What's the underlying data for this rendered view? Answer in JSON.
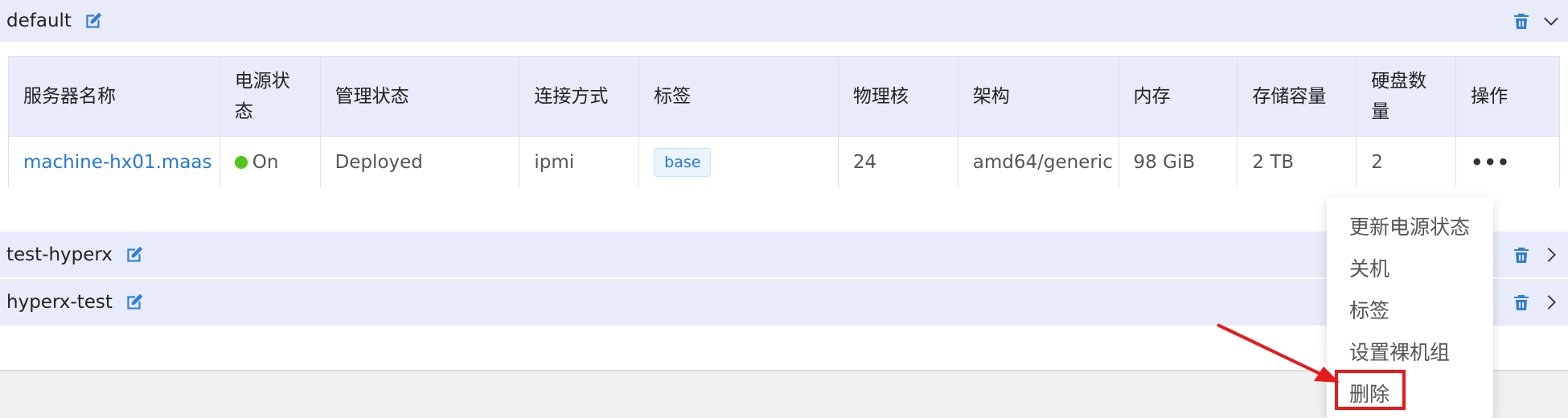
{
  "groups": [
    {
      "name": "default",
      "expanded": true
    },
    {
      "name": "test-hyperx",
      "expanded": false
    },
    {
      "name": "hyperx-test",
      "expanded": false
    }
  ],
  "table": {
    "headers": [
      "服务器名称",
      "电源状态",
      "管理状态",
      "连接方式",
      "标签",
      "物理核",
      "架构",
      "内存",
      "存储容量",
      "硬盘数量",
      "操作"
    ],
    "header_lines": {
      "power": [
        "电源状",
        "态"
      ],
      "disks": [
        "硬盘数",
        "量"
      ]
    },
    "row": {
      "name": "machine-hx01.maas",
      "power": "On",
      "status": "Deployed",
      "connection": "ipmi",
      "tag": "base",
      "cores": "24",
      "arch": "amd64/generic",
      "memory": "98 GiB",
      "storage": "2 TB",
      "disks": "2",
      "action": "•••"
    }
  },
  "dropdown": {
    "items": [
      "更新电源状态",
      "关机",
      "标签",
      "设置裸机组",
      "删除"
    ]
  },
  "colors": {
    "accent": "#2f7fd6",
    "header_bg": "#e8ebfa",
    "power_on": "#52c41a",
    "highlight": "#e51a1a"
  }
}
